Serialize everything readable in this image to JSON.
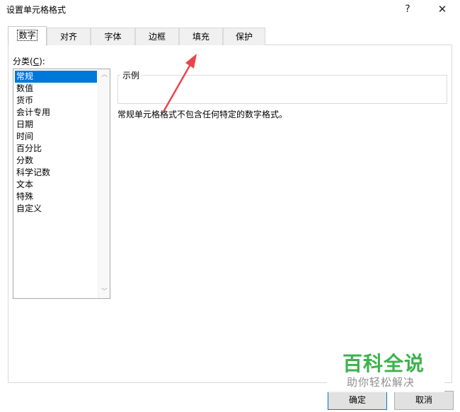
{
  "window": {
    "title": "设置单元格格式",
    "help_glyph": "?",
    "close_glyph": "✕"
  },
  "tabs": [
    {
      "label": "数字",
      "active": true
    },
    {
      "label": "对齐",
      "active": false
    },
    {
      "label": "字体",
      "active": false
    },
    {
      "label": "边框",
      "active": false
    },
    {
      "label": "填充",
      "active": false
    },
    {
      "label": "保护",
      "active": false
    }
  ],
  "category": {
    "label_prefix": "分类(",
    "label_accel": "C",
    "label_suffix": "):",
    "items": [
      "常规",
      "数值",
      "货币",
      "会计专用",
      "日期",
      "时间",
      "百分比",
      "分数",
      "科学记数",
      "文本",
      "特殊",
      "自定义"
    ],
    "selected_index": 0
  },
  "sample": {
    "label": "示例"
  },
  "description": "常规单元格格式不包含任何特定的数字格式。",
  "buttons": {
    "ok": "确定",
    "cancel": "取消"
  },
  "watermark": {
    "title": "百科全说",
    "subtitle": "助你轻松解决"
  },
  "colors": {
    "selection": "#0078d7",
    "annotation_arrow": "#e8474a",
    "watermark_green": "#3bb34a"
  }
}
